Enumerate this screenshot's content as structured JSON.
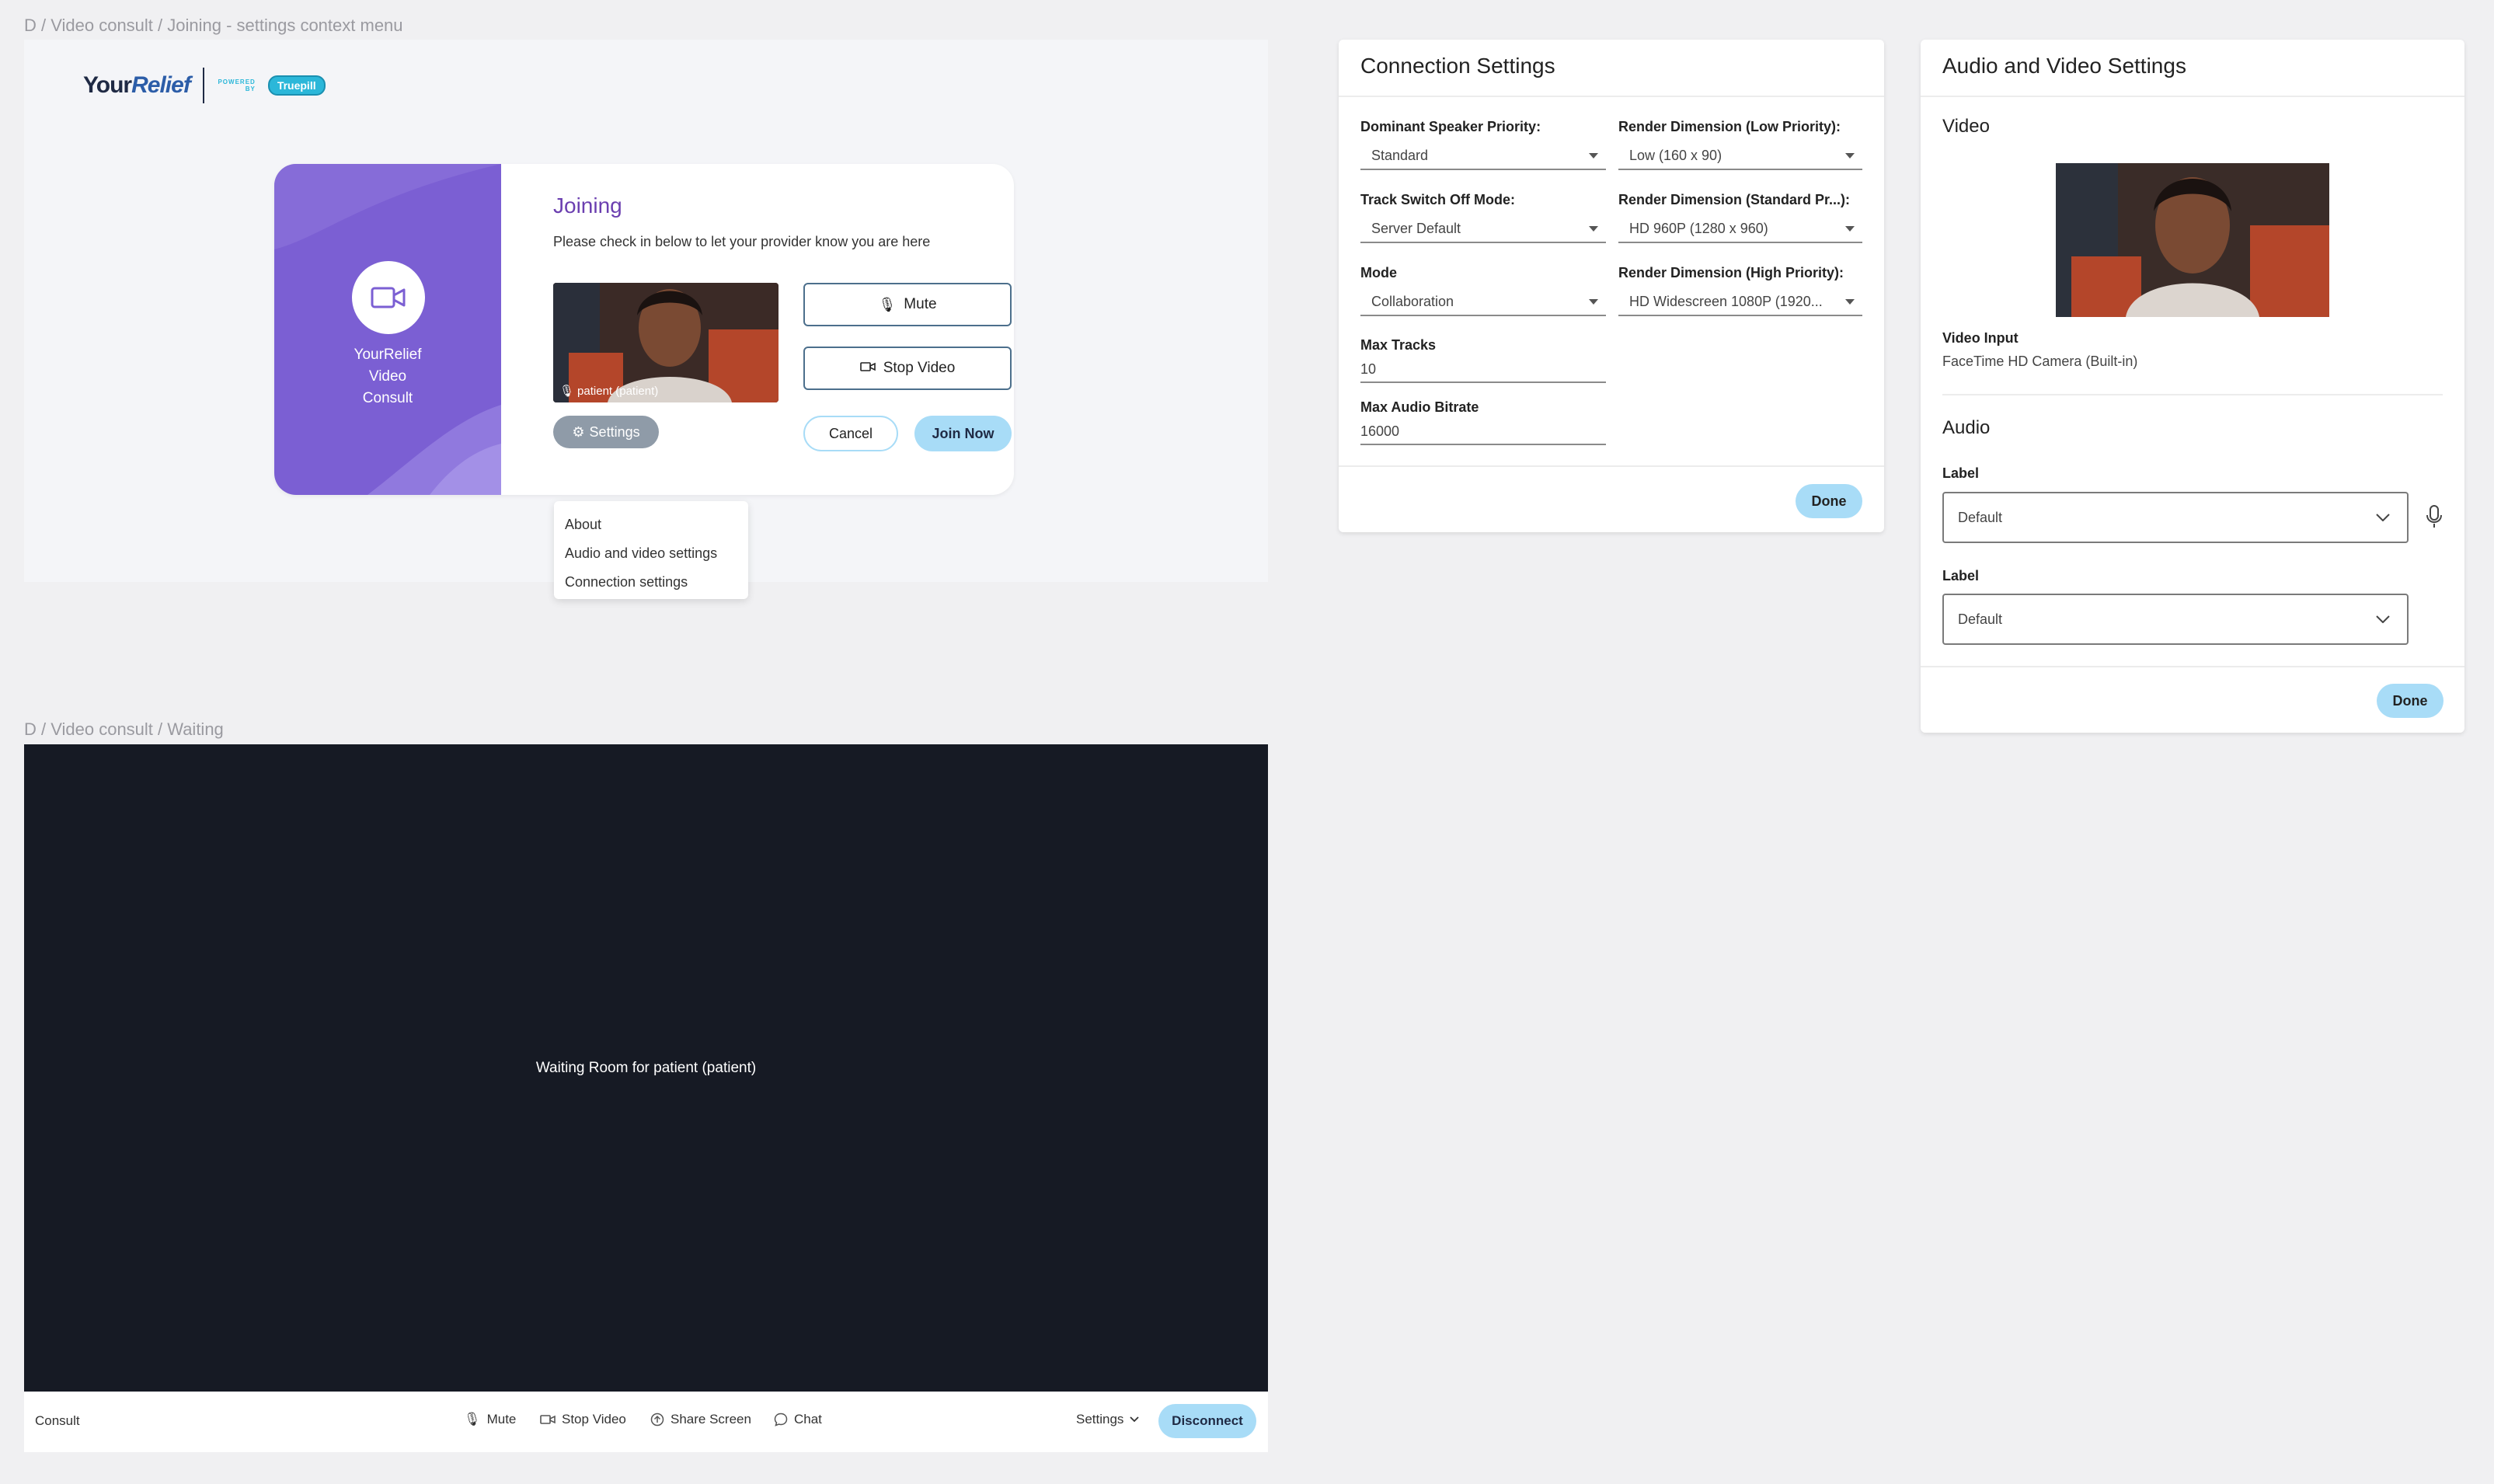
{
  "frames": {
    "joining_label": "D / Video consult / Joining - settings context menu",
    "waiting_label": "D / Video consult / Waiting"
  },
  "logo": {
    "brand_a": "Your",
    "brand_b": "Relief",
    "powered": "POWERED BY",
    "partner": "Truepill"
  },
  "joining": {
    "card_title": "YourRelief Video Consult",
    "title": "Joining",
    "subtitle": "Please check in below to let your provider know you are here",
    "preview_name": "patient (patient)",
    "mute": "Mute",
    "stop_video": "Stop Video",
    "settings": "Settings",
    "cancel": "Cancel",
    "join_now": "Join Now",
    "menu": [
      "About",
      "Audio and video settings",
      "Connection settings"
    ]
  },
  "connection": {
    "title": "Connection Settings",
    "dominant_label": "Dominant Speaker Priority:",
    "dominant_value": "Standard",
    "track_label": "Track Switch Off Mode:",
    "track_value": "Server Default",
    "mode_label": "Mode",
    "mode_value": "Collaboration",
    "max_tracks_label": "Max Tracks",
    "max_tracks_value": "10",
    "max_audio_label": "Max Audio Bitrate",
    "max_audio_value": "16000",
    "low_label": "Render Dimension (Low Priority):",
    "low_value": "Low (160 x 90)",
    "std_label": "Render Dimension (Standard Pr...):",
    "std_value": "HD 960P (1280 x 960)",
    "high_label": "Render Dimension (High Priority):",
    "high_value": "HD Widescreen 1080P (1920...",
    "done": "Done"
  },
  "audio_video": {
    "title": "Audio and Video Settings",
    "video_heading": "Video",
    "video_input_label": "Video Input",
    "video_input_value": "FaceTime HD Camera (Built-in)",
    "audio_heading": "Audio",
    "label1": "Label",
    "select1": "Default",
    "label2": "Label",
    "select2": "Default",
    "done": "Done"
  },
  "waiting": {
    "message": "Waiting Room for patient (patient)",
    "consult": "Consult",
    "mute": "Mute",
    "stop_video": "Stop Video",
    "share_screen": "Share Screen",
    "chat": "Chat",
    "settings": "Settings",
    "disconnect": "Disconnect"
  },
  "colors": {
    "brand_purple": "#7b5fd3",
    "accent_blue": "#a8dcf7",
    "dark_room": "#161a24"
  }
}
